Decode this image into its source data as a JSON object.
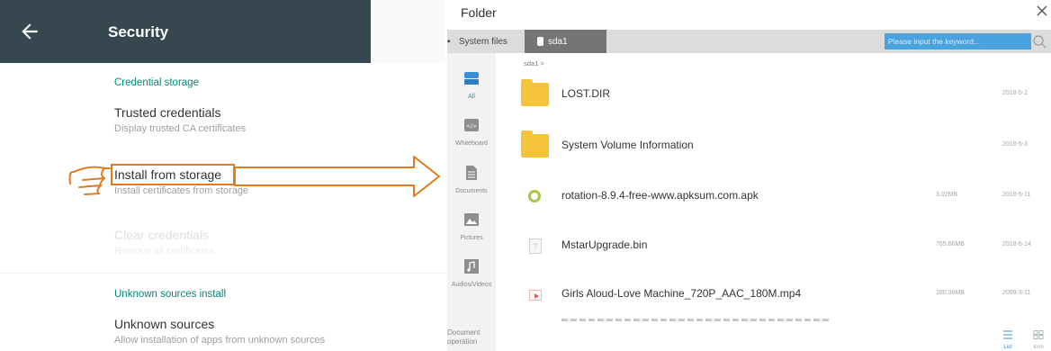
{
  "settings": {
    "title": "Security",
    "credential_storage_header": "Credential storage",
    "trusted_credentials": {
      "title": "Trusted credentials",
      "summary": "Display trusted CA certificates"
    },
    "install_from_storage": {
      "title": "Install from storage",
      "summary": "Install certificates from storage"
    },
    "clear_credentials": {
      "title": "Clear credentials",
      "summary": "Remove all certificates"
    },
    "unknown_sources_header": "Unknown sources install",
    "unknown_sources": {
      "title": "Unknown sources",
      "summary": "Allow installation of apps from unknown sources"
    },
    "accent_color": "#00897b",
    "appbar_color": "#37474f",
    "highlight_color": "#e07b1f"
  },
  "folder": {
    "title": "Folder",
    "tabs": {
      "system_files": "System files",
      "drive": "sda1"
    },
    "search_placeholder": "Please input the keyword...",
    "breadcrumb": "sda1 >",
    "sidebar": [
      {
        "label": "All",
        "icon": "drive-icon"
      },
      {
        "label": "Whiteboard",
        "icon": "whiteboard-icon"
      },
      {
        "label": "Documents",
        "icon": "document-icon"
      },
      {
        "label": "Pictures",
        "icon": "picture-icon"
      },
      {
        "label": "Audios/Videos",
        "icon": "music-icon"
      }
    ],
    "document_operation": "Document\noperation",
    "files": [
      {
        "name": "LOST.DIR",
        "size": "",
        "date": "2018-5-2",
        "type": "folder"
      },
      {
        "name": "System Volume Information",
        "size": "",
        "date": "2018-5-3",
        "type": "folder"
      },
      {
        "name": "rotation-8.9.4-free-www.apksum.com.apk",
        "size": "3.02MB",
        "date": "2018-5-11",
        "type": "apk"
      },
      {
        "name": "MstarUpgrade.bin",
        "size": "765.66MB",
        "date": "2018-6-14",
        "type": "bin"
      },
      {
        "name": "Girls Aloud-Love Machine_720P_AAC_180M.mp4",
        "size": "180.36MB",
        "date": "2009-3-11",
        "type": "mp4"
      }
    ],
    "view_list_label": "List",
    "view_icon_label": "Icon",
    "accent_color": "#4aa3df"
  }
}
